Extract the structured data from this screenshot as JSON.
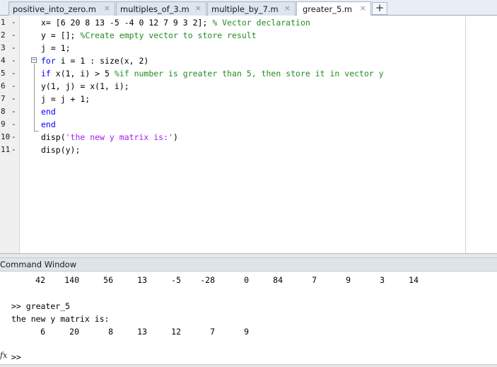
{
  "tabs": [
    {
      "label": "positive_into_zero.m",
      "close": "×"
    },
    {
      "label": "multiples_of_3.m",
      "close": "×"
    },
    {
      "label": "multiple_by_7.m",
      "close": "×"
    },
    {
      "label": "greater_5.m",
      "close": "×"
    }
  ],
  "add_tab": "+",
  "editor": {
    "line_numbers": [
      "1",
      "2",
      "3",
      "4",
      "5",
      "6",
      "7",
      "8",
      "9",
      "10",
      "11"
    ],
    "dash": "-",
    "lines": [
      [
        {
          "t": "x= [6 20 8 13 -5 -4 0 12 7 9 3 2]; ",
          "c": ""
        },
        {
          "t": "% Vector declaration",
          "c": "cm"
        }
      ],
      [
        {
          "t": "y = []; ",
          "c": ""
        },
        {
          "t": "%Create empty vector to store result",
          "c": "cm"
        }
      ],
      [
        {
          "t": "j = 1;",
          "c": ""
        }
      ],
      [
        {
          "t": "for",
          "c": "kw"
        },
        {
          "t": " i = 1 : size(x, 2)",
          "c": ""
        }
      ],
      [
        {
          "t": "if",
          "c": "kw"
        },
        {
          "t": " x(1, i) > 5 ",
          "c": ""
        },
        {
          "t": "%if number is greater than 5, then store it in vector y",
          "c": "cm"
        }
      ],
      [
        {
          "t": "y(1, j) = x(1, i);",
          "c": ""
        }
      ],
      [
        {
          "t": "j = j + 1;",
          "c": ""
        }
      ],
      [
        {
          "t": "end",
          "c": "kw"
        }
      ],
      [
        {
          "t": "end",
          "c": "kw"
        }
      ],
      [
        {
          "t": "disp(",
          "c": ""
        },
        {
          "t": "'the new y matrix is:'",
          "c": "str"
        },
        {
          "t": ")",
          "c": ""
        }
      ],
      [
        {
          "t": "disp(y);",
          "c": ""
        }
      ]
    ]
  },
  "command_window": {
    "title": "Command Window",
    "prev_output": [
      "42",
      "140",
      "56",
      "13",
      "-5",
      "-28",
      "0",
      "84",
      "7",
      "9",
      "3",
      "14"
    ],
    "command": ">> greater_5",
    "message": "the new y matrix is:",
    "result": [
      "6",
      "20",
      "8",
      "13",
      "12",
      "7",
      "9"
    ],
    "fx_icon": "fx",
    "prompt": ">>"
  },
  "colors": {
    "keyword": "#0000ff",
    "comment": "#228b22",
    "string": "#a020f0"
  }
}
